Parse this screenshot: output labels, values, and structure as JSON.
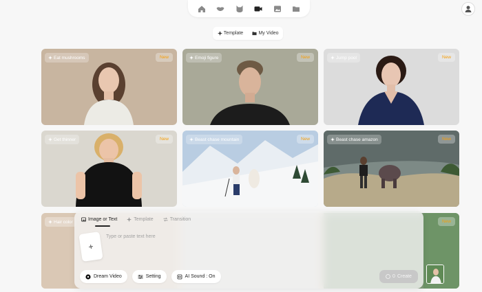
{
  "nav": {
    "items": [
      {
        "icon": "home-icon"
      },
      {
        "icon": "lips-icon"
      },
      {
        "icon": "cat-icon"
      },
      {
        "icon": "video-camera-icon",
        "active": true
      },
      {
        "icon": "image-icon"
      },
      {
        "icon": "folder-icon"
      }
    ]
  },
  "segmented": {
    "template_label": "Template",
    "my_video_label": "My Video"
  },
  "cards": [
    {
      "title": "Eat mushrooms",
      "badge": "New"
    },
    {
      "title": "Emoji figure",
      "badge": "New"
    },
    {
      "title": "Jump pool",
      "badge": "New"
    },
    {
      "title": "Get thinner",
      "badge": "New"
    },
    {
      "title": "Beast chase mountain",
      "badge": "New"
    },
    {
      "title": "Beast chase amazon",
      "badge": "New"
    }
  ],
  "bottom_row": {
    "card_title": "Hair color",
    "card_badge": "New"
  },
  "composer": {
    "tabs": [
      {
        "label": "Image or Text",
        "active": true
      },
      {
        "label": "Template"
      },
      {
        "label": "Transition"
      }
    ],
    "add_label": "+",
    "prompt_placeholder": "Type or paste text here",
    "dream_video_label": "Dream Video",
    "setting_label": "Setting",
    "ai_sound_label": "AI Sound : On",
    "create_label": "Create",
    "create_cost": "0"
  },
  "colors": {
    "accent_badge": "#f59e0b",
    "background": "#f7f7f7"
  }
}
